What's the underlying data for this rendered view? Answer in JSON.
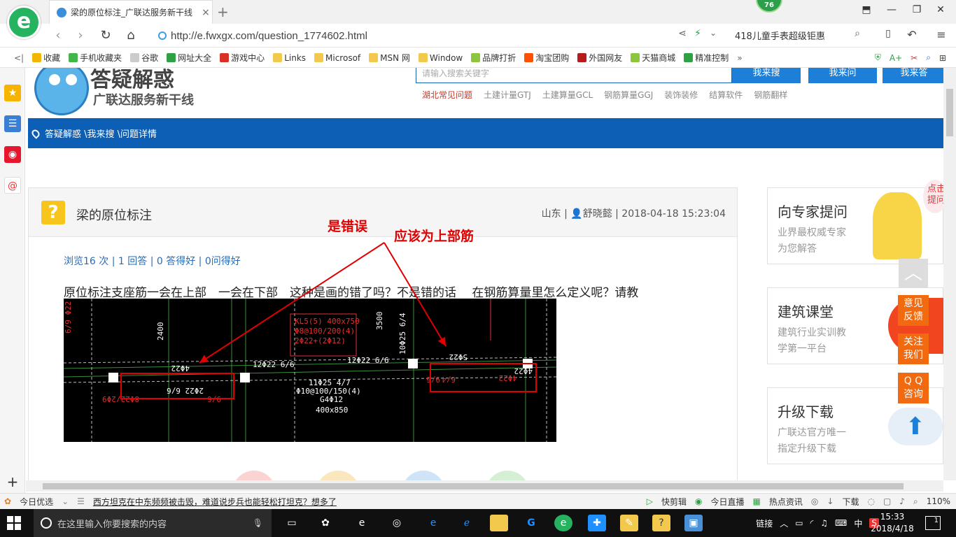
{
  "browser": {
    "tab_title": "梁的原位标注_广联达服务新干线",
    "tab_close": "×",
    "new_tab": "+",
    "badge": "76",
    "url": "http://e.fwxgx.com/question_1774602.html",
    "search_hint": "418儿童手表超级钜惠",
    "back": "‹",
    "forward": "›",
    "reload": "↻",
    "home": "⌂"
  },
  "favorites": {
    "toggle": "<|",
    "items": [
      {
        "label": "收藏",
        "color": "#f2b600"
      },
      {
        "label": "手机收藏夹",
        "color": "#43b649"
      },
      {
        "label": "谷歌",
        "color": "#cccccc"
      },
      {
        "label": "网址大全",
        "color": "#2da144"
      },
      {
        "label": "游戏中心",
        "color": "#d93025"
      },
      {
        "label": "Links",
        "color": "#f2c94c"
      },
      {
        "label": "Microsof",
        "color": "#f2c94c"
      },
      {
        "label": "MSN 网",
        "color": "#f2c94c"
      },
      {
        "label": "Window",
        "color": "#f2c94c"
      },
      {
        "label": "品牌打折",
        "color": "#8cc63f"
      },
      {
        "label": "淘宝团购",
        "color": "#ff5000"
      },
      {
        "label": "外国网友",
        "color": "#b71c1c"
      },
      {
        "label": "天猫商城",
        "color": "#8cc63f"
      },
      {
        "label": "精准控制",
        "color": "#2da144"
      }
    ],
    "more": "»"
  },
  "site": {
    "title": "答疑解惑",
    "subtitle": "广联达服务新干线",
    "search_placeholder": "请输入搜索关键字",
    "buttons": [
      "我来搜",
      "我来问",
      "我来答"
    ],
    "categories": [
      "湖北常见问题",
      "土建计量GTJ",
      "土建算量GCL",
      "钢筋算量GGJ",
      "装饰装修",
      "结算软件",
      "钢筋翻样"
    ],
    "breadcrumb": "答疑解惑 \\我来搜 \\问题详情"
  },
  "question": {
    "title": "梁的原位标注",
    "meta": "山东 | 👤舒晓懿 | 2018-04-18 15:23:04",
    "stats": "浏览16 次 | 1 回答 | 0 答得好 | 0问得好",
    "body": "原位标注支座筋一会在上部　一会在下部　这种是画的错了吗？不是错的话　 在钢筋算量里怎么定义呢？请教",
    "annotation_wrong": "是错误",
    "annotation_top": "应该为上部筋"
  },
  "cad_labels": {
    "a": "8Φ22/2Φ9",
    "b": "9/6",
    "c": "6/4",
    "d": "4Φ22",
    "e": "9/6",
    "f": "2Φ22 6/6",
    "g": "12Φ22 6/6",
    "h": "12Φ22 6/6",
    "i": "11Φ25 4/7",
    "j": "Φ10@100/150(4)",
    "k": "G4Φ12",
    "l": "400x850",
    "m": "KL5(5) 400x750",
    "n": "Φ8@100/200(4)",
    "o": "2Φ22+(2Φ12)",
    "p": "2400",
    "q": "3500",
    "r": "4Φ22",
    "s": "10Φ25 6/4",
    "t": "5Φ22",
    "u": "6/9 Φ22 12",
    "v": "4Φ22"
  },
  "sidebar_right": [
    {
      "title": "向专家提问",
      "line1": "业界最权威专家",
      "line2": "为您解答"
    },
    {
      "title": "建筑课堂",
      "line1": "建筑行业实训教",
      "line2": "学第一平台"
    },
    {
      "title": "升级下载",
      "line1": "广联达官方唯一",
      "line2": "指定升级下载"
    }
  ],
  "float_buttons": [
    "意见\n反馈",
    "关注\n我们",
    "Q Q\n咨询"
  ],
  "float_top": "点击\n提问",
  "status": {
    "today": "今日优选",
    "news": "西方坦克在中东频频被击毁，难道说步兵也能轻松打坦克？想多了",
    "items": [
      "快剪辑",
      "今日直播",
      "热点资讯",
      "下载"
    ],
    "zoom": "110%"
  },
  "taskbar": {
    "search_placeholder": "在这里输入你要搜索的内容",
    "tray_link": "链接",
    "ime": "中",
    "time": "15:33",
    "date": "2018/4/18",
    "notifications": "1"
  }
}
